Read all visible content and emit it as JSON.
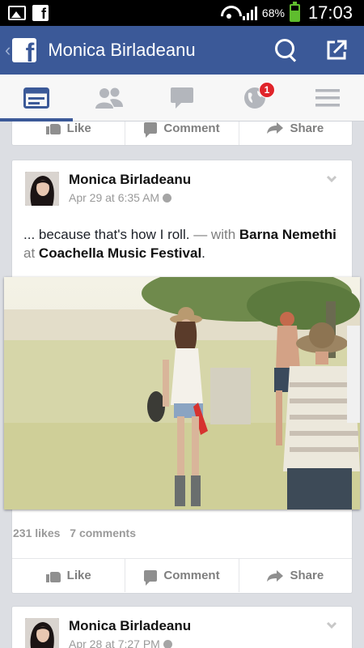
{
  "status_bar": {
    "battery_percent": "68%",
    "battery_level": 0.68,
    "time": "17:03",
    "icons": [
      "image-notification-icon",
      "facebook-notification-icon",
      "wifi-icon",
      "signal-icon",
      "battery-icon"
    ]
  },
  "header": {
    "title": "Monica Birladeanu",
    "back_icon": "chevron-left-icon",
    "logo_letter": "f",
    "search_icon": "search-icon",
    "share_icon": "share-external-icon"
  },
  "nav": {
    "tabs": [
      {
        "name": "news-feed",
        "icon": "news-feed-icon",
        "active": true
      },
      {
        "name": "friend-requests",
        "icon": "friends-icon",
        "active": false
      },
      {
        "name": "messages",
        "icon": "messages-icon",
        "active": false
      },
      {
        "name": "notifications",
        "icon": "globe-icon",
        "active": false,
        "badge": "1"
      },
      {
        "name": "more",
        "icon": "menu-icon",
        "active": false
      }
    ]
  },
  "actions": {
    "like": "Like",
    "comment": "Comment",
    "share": "Share"
  },
  "posts": [
    {
      "author": "Monica Birladeanu",
      "date": "Apr 29 at 6:35 AM",
      "text_prefix": "... because that's how I roll.",
      "text_with": "— with",
      "tagged_person": "Barna Nemethi",
      "text_at": "at",
      "place": "Coachella Music Festival",
      "text_end": ".",
      "likes": "231 likes",
      "comments": "7 comments"
    },
    {
      "author": "Monica Birladeanu",
      "date": "Apr 28 at 7:27 PM"
    }
  ],
  "colors": {
    "facebook_blue": "#3b5998",
    "badge_red": "#e0242a",
    "feed_bg": "#dcdee3"
  }
}
